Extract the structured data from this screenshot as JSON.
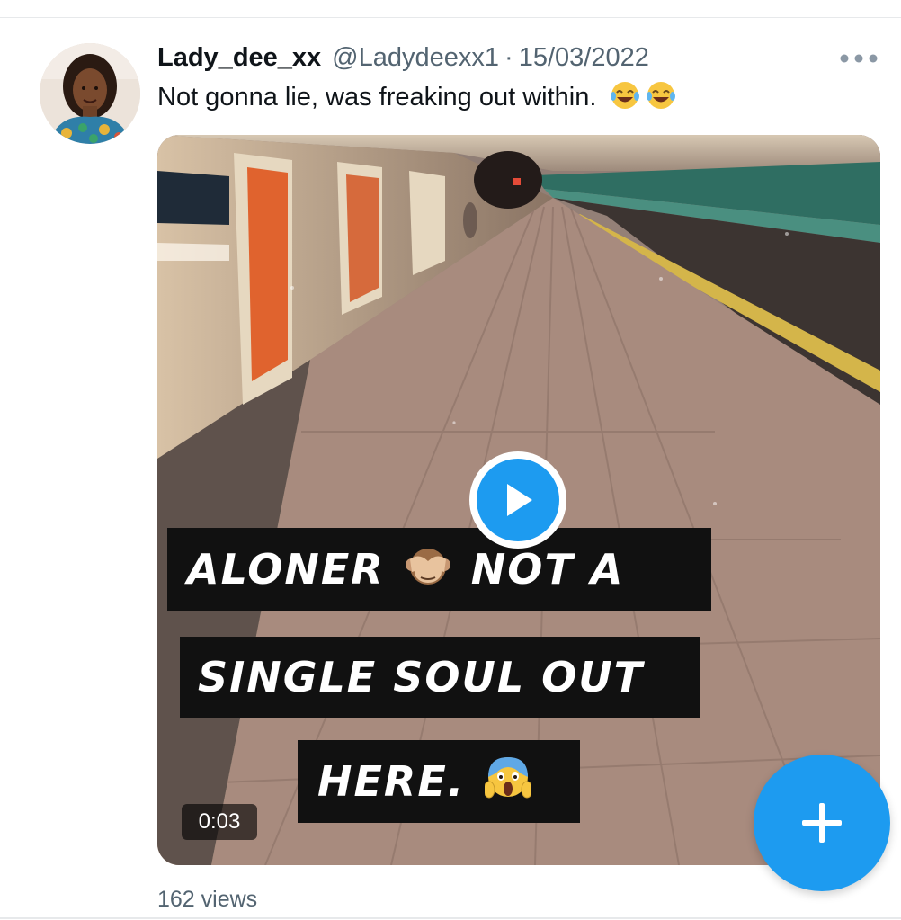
{
  "tweet": {
    "display_name": "Lady_dee_xx",
    "handle": "@Ladydeexx1",
    "separator": "·",
    "date": "15/03/2022",
    "text": "Not gonna lie, was freaking out within.",
    "text_emojis": "😂😂",
    "views": "162 views"
  },
  "media": {
    "caption_line_1a": "ALONER",
    "caption_line_1_emoji": "🙈",
    "caption_line_1b": "NOT A",
    "caption_line_2": "SINGLE SOUL OUT",
    "caption_line_3": "HERE.",
    "caption_line_3_emoji": "😱",
    "duration": "0:03",
    "play_icon": "play-icon"
  },
  "icons": {
    "more": "more-dots-icon",
    "compose": "plus-icon"
  },
  "colors": {
    "accent": "#1d9bf0",
    "text_primary": "#0f1419",
    "text_secondary": "#536471"
  }
}
